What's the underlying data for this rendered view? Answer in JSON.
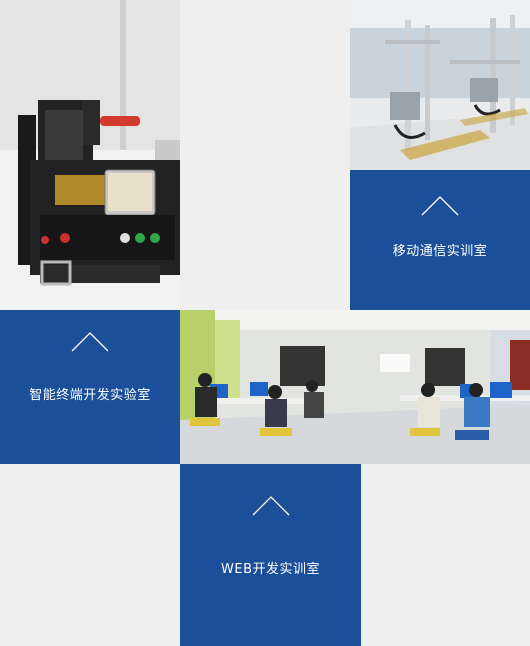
{
  "tiles": {
    "mobile_lab": {
      "label": "移动通信实训室",
      "icon": "chevron-up-icon"
    },
    "smart_lab": {
      "label": "智能终端开发实验室",
      "icon": "chevron-up-icon"
    },
    "web_lab": {
      "label": "WEB开发实训室",
      "icon": "chevron-up-icon"
    }
  },
  "colors": {
    "tile_blue": "#1b4f99",
    "page_bg": "#efefef"
  }
}
